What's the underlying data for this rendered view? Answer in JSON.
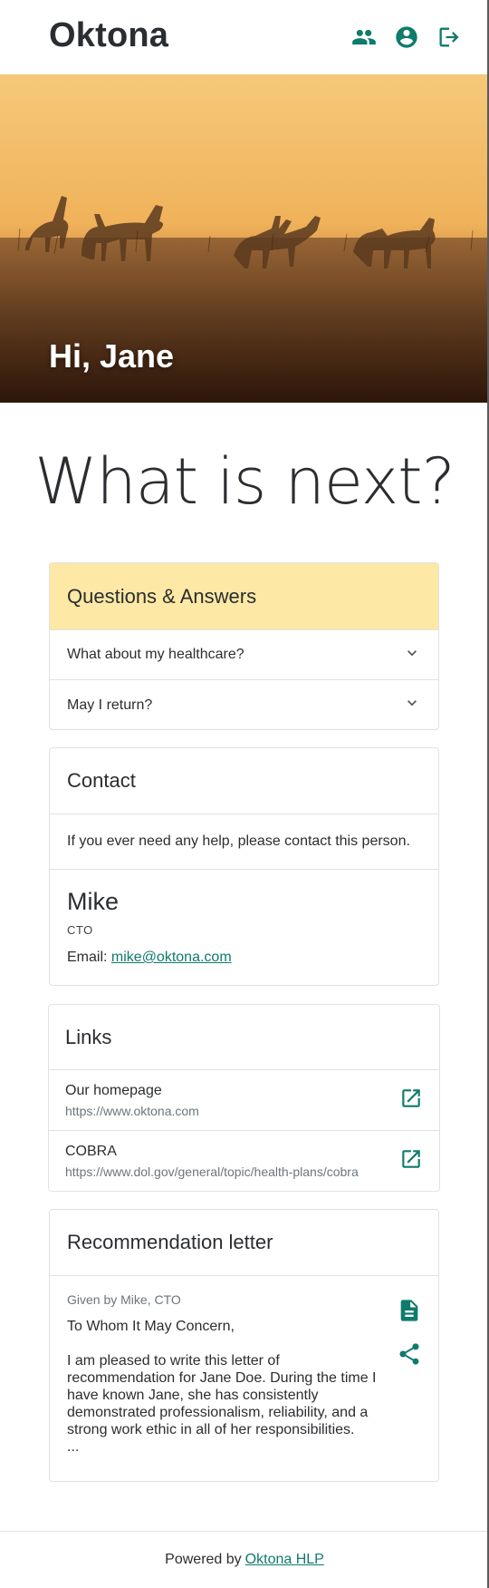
{
  "app": {
    "name": "Oktona"
  },
  "header": {
    "icons": [
      "people-icon",
      "account-circle-icon",
      "logout-icon"
    ]
  },
  "hero": {
    "greeting": "Hi, Jane"
  },
  "main": {
    "title": "What is next?"
  },
  "qa": {
    "title": "Questions & Answers",
    "items": [
      {
        "question": "What about my healthcare?"
      },
      {
        "question": "May I return?"
      }
    ]
  },
  "contact": {
    "title": "Contact",
    "intro": "If you ever need any help, please contact this person.",
    "name": "Mike",
    "role": "CTO",
    "email_label": "Email:",
    "email": "mike@oktona.com"
  },
  "links": {
    "title": "Links",
    "items": [
      {
        "title": "Our homepage",
        "url": "https://www.oktona.com"
      },
      {
        "title": "COBRA",
        "url": "https://www.dol.gov/general/topic/health-plans/cobra"
      }
    ]
  },
  "recommendation": {
    "title": "Recommendation letter",
    "given_by": "Given by Mike, CTO",
    "text": "To Whom It May Concern,\n\nI am pleased to write this letter of recommendation for Jane Doe. During the time I have known Jane, she has consistently demonstrated professionalism, reliability, and a strong work ethic in all of her responsibilities.\n..."
  },
  "footer": {
    "prefix": "Powered by",
    "link_text": "Oktona HLP"
  },
  "colors": {
    "accent": "#0f7b6c",
    "qa_header_bg": "#fde9a5",
    "text": "#2b2d30",
    "muted": "#6c757d"
  }
}
